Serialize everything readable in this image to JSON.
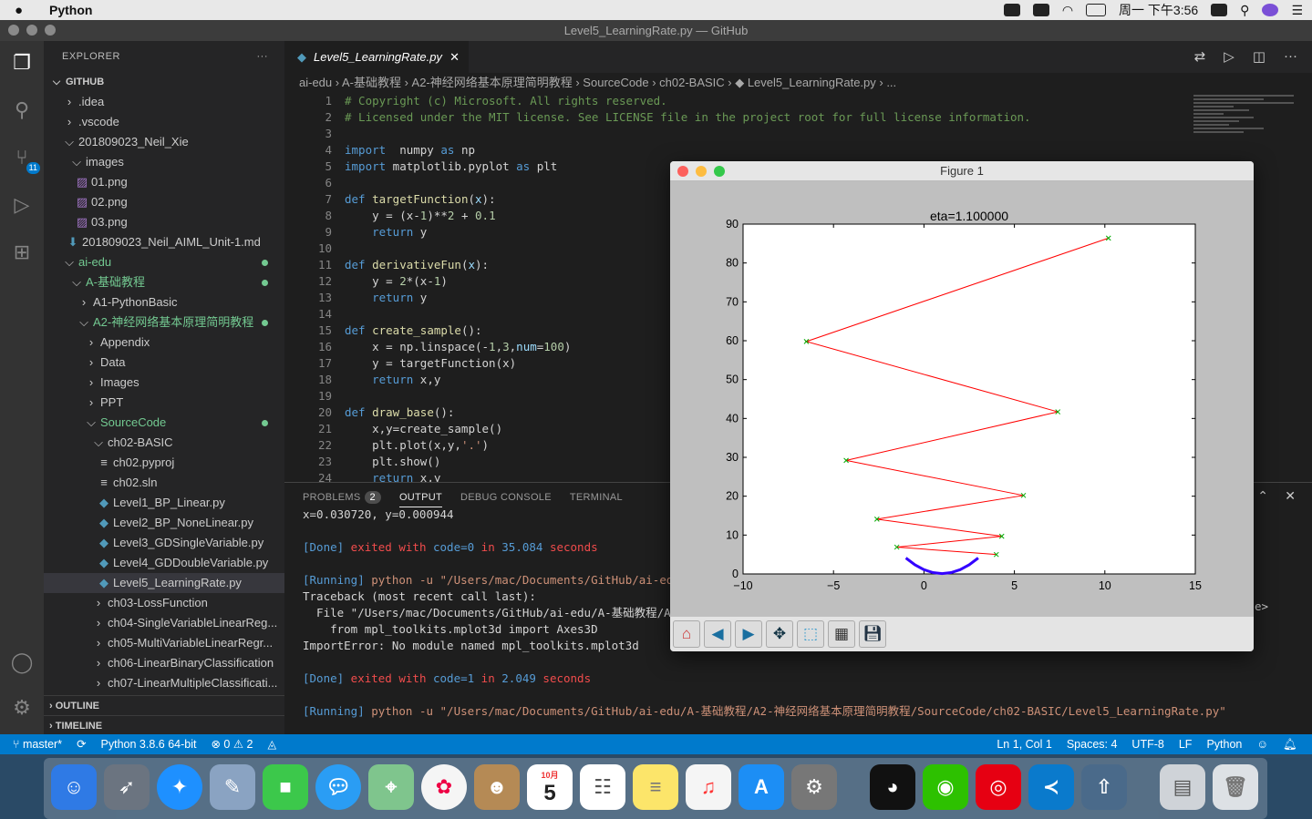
{
  "menubar": {
    "app": "Python",
    "clock": "周一 下午3:56"
  },
  "window": {
    "title": "Level5_LearningRate.py — GitHub"
  },
  "explorer": {
    "header": "EXPLORER",
    "more": "···",
    "rows": [
      {
        "label": "GITHUB",
        "ind": 6,
        "ic": "⌵",
        "bold": true
      },
      {
        "label": ".idea",
        "ind": 20,
        "ic": "›"
      },
      {
        "label": ".vscode",
        "ind": 20,
        "ic": "›"
      },
      {
        "label": "201809023_Neil_Xie",
        "ind": 20,
        "ic": "⌵"
      },
      {
        "label": "images",
        "ind": 28,
        "ic": "⌵"
      },
      {
        "label": "01.png",
        "ind": 34,
        "ic": "▨",
        "icc": "#a074c4"
      },
      {
        "label": "02.png",
        "ind": 34,
        "ic": "▨",
        "icc": "#a074c4"
      },
      {
        "label": "03.png",
        "ind": 34,
        "ic": "▨",
        "icc": "#a074c4"
      },
      {
        "label": "201809023_Neil_AIML_Unit-1.md",
        "ind": 24,
        "ic": "⬇",
        "icc": "#519aba"
      },
      {
        "label": "ai-edu",
        "ind": 20,
        "ic": "⌵",
        "green": true,
        "dot": true
      },
      {
        "label": "A-基础教程",
        "ind": 28,
        "ic": "⌵",
        "green": true,
        "dot": true
      },
      {
        "label": "A1-PythonBasic",
        "ind": 36,
        "ic": "›"
      },
      {
        "label": "A2-神经网络基本原理简明教程",
        "ind": 36,
        "ic": "⌵",
        "green": true,
        "dot": true
      },
      {
        "label": "Appendix",
        "ind": 44,
        "ic": "›"
      },
      {
        "label": "Data",
        "ind": 44,
        "ic": "›"
      },
      {
        "label": "Images",
        "ind": 44,
        "ic": "›"
      },
      {
        "label": "PPT",
        "ind": 44,
        "ic": "›"
      },
      {
        "label": "SourceCode",
        "ind": 44,
        "ic": "⌵",
        "green": true,
        "dot": true
      },
      {
        "label": "ch02-BASIC",
        "ind": 52,
        "ic": "⌵"
      },
      {
        "label": "ch02.pyproj",
        "ind": 58,
        "ic": "≡"
      },
      {
        "label": "ch02.sln",
        "ind": 58,
        "ic": "≡"
      },
      {
        "label": "Level1_BP_Linear.py",
        "ind": 58,
        "ic": "◆",
        "icc": "#519aba"
      },
      {
        "label": "Level2_BP_NoneLinear.py",
        "ind": 58,
        "ic": "◆",
        "icc": "#519aba"
      },
      {
        "label": "Level3_GDSingleVariable.py",
        "ind": 58,
        "ic": "◆",
        "icc": "#519aba"
      },
      {
        "label": "Level4_GDDoubleVariable.py",
        "ind": 58,
        "ic": "◆",
        "icc": "#519aba"
      },
      {
        "label": "Level5_LearningRate.py",
        "ind": 58,
        "ic": "◆",
        "icc": "#519aba",
        "sel": true
      },
      {
        "label": "ch03-LossFunction",
        "ind": 52,
        "ic": "›"
      },
      {
        "label": "ch04-SingleVariableLinearReg...",
        "ind": 52,
        "ic": "›"
      },
      {
        "label": "ch05-MultiVariableLinearRegr...",
        "ind": 52,
        "ic": "›"
      },
      {
        "label": "ch06-LinearBinaryClassification",
        "ind": 52,
        "ic": "›"
      },
      {
        "label": "ch07-LinearMultipleClassificati...",
        "ind": 52,
        "ic": "›"
      }
    ],
    "outline": "OUTLINE",
    "timeline": "TIMELINE"
  },
  "activity": {
    "badge": "11"
  },
  "tab": {
    "label": "Level5_LearningRate.py",
    "close": "✕"
  },
  "breadcrumb": "ai-edu › A-基础教程 › A2-神经网络基本原理简明教程 › SourceCode › ch02-BASIC › ◆ Level5_LearningRate.py › ...",
  "code": [
    [
      [
        "cm",
        "# Copyright (c) Microsoft. All rights reserved."
      ]
    ],
    [
      [
        "cm",
        "# Licensed under the MIT license. See LICENSE file in the project root for full license information."
      ]
    ],
    [],
    [
      [
        "kw",
        "import"
      ],
      [
        "",
        "  numpy "
      ],
      [
        "kw",
        "as"
      ],
      [
        "",
        " np"
      ]
    ],
    [
      [
        "kw",
        "import"
      ],
      [
        "",
        " matplotlib.pyplot "
      ],
      [
        "kw",
        "as"
      ],
      [
        "",
        " plt"
      ]
    ],
    [],
    [
      [
        "kw",
        "def"
      ],
      [
        "",
        " "
      ],
      [
        "fn",
        "targetFunction"
      ],
      [
        "",
        "("
      ],
      [
        "pa",
        "x"
      ],
      [
        "",
        "):"
      ]
    ],
    [
      [
        "",
        "    y = (x-"
      ],
      [
        "nm",
        "1"
      ],
      [
        "",
        ")**"
      ],
      [
        "nm",
        "2"
      ],
      [
        "",
        " + "
      ],
      [
        "nm",
        "0.1"
      ]
    ],
    [
      [
        "",
        "    "
      ],
      [
        "kw",
        "return"
      ],
      [
        "",
        " y"
      ]
    ],
    [],
    [
      [
        "kw",
        "def"
      ],
      [
        "",
        " "
      ],
      [
        "fn",
        "derivativeFun"
      ],
      [
        "",
        "("
      ],
      [
        "pa",
        "x"
      ],
      [
        "",
        "):"
      ]
    ],
    [
      [
        "",
        "    y = "
      ],
      [
        "nm",
        "2"
      ],
      [
        "",
        "*(x-"
      ],
      [
        "nm",
        "1"
      ],
      [
        "",
        ")"
      ]
    ],
    [
      [
        "",
        "    "
      ],
      [
        "kw",
        "return"
      ],
      [
        "",
        " y"
      ]
    ],
    [],
    [
      [
        "kw",
        "def"
      ],
      [
        "",
        " "
      ],
      [
        "fn",
        "create_sample"
      ],
      [
        "",
        "():"
      ]
    ],
    [
      [
        "",
        "    x = np.linspace(-"
      ],
      [
        "nm",
        "1"
      ],
      [
        "",
        ","
      ],
      [
        "nm",
        "3"
      ],
      [
        "",
        ","
      ],
      [
        "pa",
        "num"
      ],
      [
        "",
        "="
      ],
      [
        "nm",
        "100"
      ],
      [
        "",
        ")"
      ]
    ],
    [
      [
        "",
        "    y = targetFunction(x)"
      ]
    ],
    [
      [
        "",
        "    "
      ],
      [
        "kw",
        "return"
      ],
      [
        "",
        " x,y"
      ]
    ],
    [],
    [
      [
        "kw",
        "def"
      ],
      [
        "",
        " "
      ],
      [
        "fn",
        "draw_base"
      ],
      [
        "",
        "():"
      ]
    ],
    [
      [
        "",
        "    x,y=create_sample()"
      ]
    ],
    [
      [
        "",
        "    plt.plot(x,y,"
      ],
      [
        "str",
        "'.'"
      ],
      [
        "",
        ")"
      ]
    ],
    [
      [
        "",
        "    plt.show()"
      ]
    ],
    [
      [
        "",
        "    "
      ],
      [
        "kw",
        "return"
      ],
      [
        "",
        " x,y"
      ]
    ]
  ],
  "panel": {
    "tabs": [
      "PROBLEMS",
      "OUTPUT",
      "DEBUG CONSOLE",
      "TERMINAL"
    ],
    "problems_count": "2",
    "lines": [
      [
        [
          "wht",
          "x=0.030720, y=0.000944"
        ]
      ],
      [],
      [
        [
          "blue",
          "[Done]"
        ],
        [
          "red",
          " exited with "
        ],
        [
          "blue",
          "code=0"
        ],
        [
          "red",
          " in "
        ],
        [
          "blue",
          "35.084"
        ],
        [
          "red",
          " seconds"
        ]
      ],
      [],
      [
        [
          "blue",
          "[Running]"
        ],
        [
          "yel",
          " python -u \"/Users/mac/Documents/GitHub/ai-edu/"
        ]
      ],
      [
        [
          "wht",
          "Traceback (most recent call last):"
        ]
      ],
      [
        [
          "wht",
          "  File \"/Users/mac/Documents/GitHub/ai-edu/A-基础教程/A2-"
        ]
      ],
      [
        [
          "wht",
          "    from mpl_toolkits.mplot3d import Axes3D"
        ]
      ],
      [
        [
          "wht",
          "ImportError: No module named mpl_toolkits.mplot3d"
        ]
      ],
      [],
      [
        [
          "blue",
          "[Done]"
        ],
        [
          "red",
          " exited with "
        ],
        [
          "blue",
          "code=1"
        ],
        [
          "red",
          " in "
        ],
        [
          "blue",
          "2.049"
        ],
        [
          "red",
          " seconds"
        ]
      ],
      [],
      [
        [
          "blue",
          "[Running]"
        ],
        [
          "yel",
          " python -u \"/Users/mac/Documents/GitHub/ai-edu/A-基础教程/A2-神经网络基本原理简明教程/SourceCode/ch02-BASIC/Level5_LearningRate.py\""
        ]
      ]
    ],
    "side_glyph": "e>"
  },
  "status": {
    "branch": "master*",
    "python": "Python 3.8.6 64-bit",
    "problems": "⊗ 0 ⚠ 2",
    "position": "Ln 1, Col 1",
    "spaces": "Spaces: 4",
    "encoding": "UTF-8",
    "eol": "LF",
    "language": "Python"
  },
  "figure": {
    "title": "Figure 1"
  },
  "chart_data": {
    "type": "line",
    "title": "eta=1.100000",
    "xlim": [
      -10,
      15
    ],
    "ylim": [
      0,
      90
    ],
    "xticks": [
      -10,
      -5,
      0,
      5,
      10,
      15
    ],
    "yticks": [
      0,
      10,
      20,
      30,
      40,
      50,
      60,
      70,
      80,
      90
    ],
    "series": [
      {
        "color": "#ff0000",
        "marker": "x",
        "marker_color": "#00aa00",
        "x": [
          4.0,
          -1.5,
          4.3,
          -2.6,
          5.5,
          -4.3,
          7.4,
          -6.5,
          10.2
        ],
        "y": [
          5.0,
          6.9,
          9.7,
          14.1,
          20.2,
          29.2,
          41.7,
          59.8,
          86.4
        ]
      },
      {
        "color": "#3300ff",
        "x": [
          -1.0,
          -0.5,
          0.0,
          0.5,
          1.0,
          1.5,
          2.0,
          2.5,
          3.0
        ],
        "y": [
          4.1,
          2.35,
          1.1,
          0.35,
          0.1,
          0.35,
          1.1,
          2.35,
          4.1
        ]
      }
    ]
  },
  "dock": {
    "calendar_month": "10月",
    "calendar_day": "5"
  }
}
